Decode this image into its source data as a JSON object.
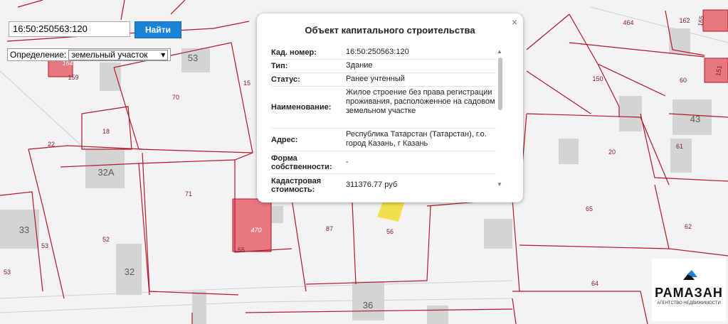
{
  "search": {
    "value": "16:50:250563:120",
    "button_label": "Найти"
  },
  "definition": {
    "label": "Определение:",
    "selected": "земельный участок"
  },
  "popup": {
    "title": "Объект капитального строительства",
    "close": "×",
    "rows": [
      {
        "key": "Кад. номер:",
        "value": "16:50:250563:120"
      },
      {
        "key": "Тип:",
        "value": "Здание"
      },
      {
        "key": "Статус:",
        "value": "Ранее учтенный"
      },
      {
        "key": "Наименование:",
        "value": "Жилое строение без права регистрации проживания, расположенное на садовом земельном участке"
      },
      {
        "key": "Адрес:",
        "value": "Республика Татарстан (Татарстан), г.о. город Казань, г Казань"
      },
      {
        "key": "Форма собственности:",
        "value": "-"
      },
      {
        "key": "Кадастровая стоимость:",
        "value": "311376.77 руб"
      }
    ]
  },
  "map": {
    "parcel_labels": [
      "164",
      "159",
      "70",
      "15",
      "18",
      "22",
      "71",
      "52",
      "53",
      "53",
      "87",
      "56",
      "464",
      "162",
      "165",
      "150",
      "60",
      "151",
      "20",
      "61",
      "65",
      "62",
      "64",
      "55"
    ],
    "house_labels": [
      "53",
      "32А",
      "33",
      "32",
      "36",
      "43"
    ],
    "red_labels": [
      "470"
    ],
    "colors": {
      "parcel_line": "#b0172e",
      "house": "#d0d0d0",
      "red_fill": "#e8787e",
      "highlight": "#f2e04a"
    }
  },
  "logo": {
    "name": "РАМАЗАН",
    "subtitle": "АГЕНТСТВО НЕДВИЖИМОСТИ"
  }
}
